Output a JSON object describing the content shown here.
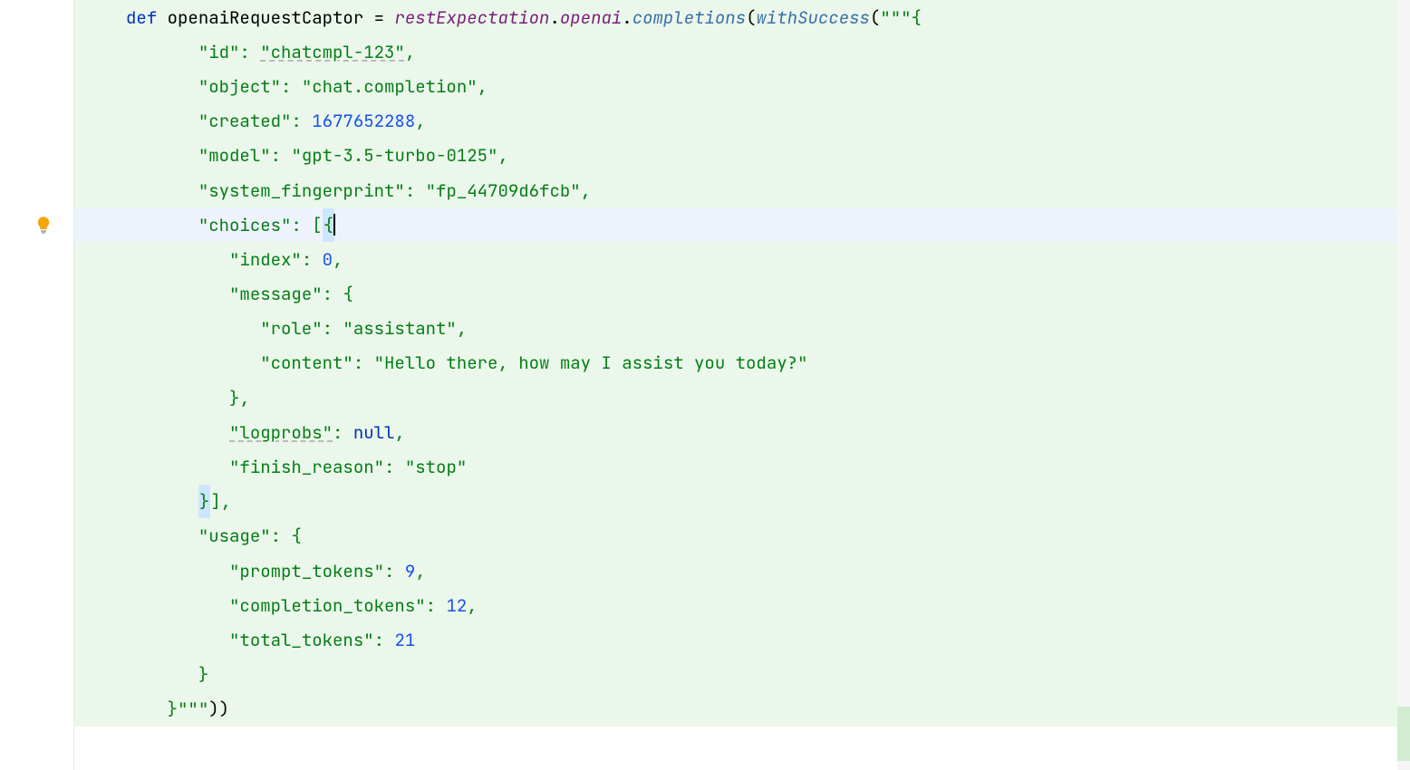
{
  "code": {
    "line1": {
      "indent": "     ",
      "kw_def": "def",
      "sp1": " ",
      "ident": "openaiRequestCaptor",
      "sp2": " ",
      "eq": "=",
      "sp3": " ",
      "member": "restExpectation",
      "dot1": ".",
      "openai": "openai",
      "dot2": ".",
      "completions": "completions",
      "paren_open": "(",
      "withSuccess": "withSuccess",
      "paren2": "(",
      "triple": "\"\"\"",
      "brace": "{"
    },
    "line2": {
      "indent": "            ",
      "key": "\"id\"",
      "colon": ": ",
      "val": "\"chatcmpl-123\"",
      "comma": ","
    },
    "line3": {
      "indent": "            ",
      "key": "\"object\"",
      "colon": ": ",
      "val": "\"chat.completion\"",
      "comma": ","
    },
    "line4": {
      "indent": "            ",
      "key": "\"created\"",
      "colon": ": ",
      "val": "1677652288",
      "comma": ","
    },
    "line5": {
      "indent": "            ",
      "key": "\"model\"",
      "colon": ": ",
      "val": "\"gpt-3.5-turbo-0125\"",
      "comma": ","
    },
    "line6": {
      "indent": "            ",
      "key": "\"system_fingerprint\"",
      "colon": ": ",
      "val": "\"fp_44709d6fcb\"",
      "comma": ","
    },
    "line7": {
      "indent": "            ",
      "key": "\"choices\"",
      "colon": ": ",
      "bracket": "[",
      "brace": "{"
    },
    "line8": {
      "indent": "               ",
      "key": "\"index\"",
      "colon": ": ",
      "val": "0",
      "comma": ","
    },
    "line9": {
      "indent": "               ",
      "key": "\"message\"",
      "colon": ": ",
      "brace": "{"
    },
    "line10": {
      "indent": "                  ",
      "key": "\"role\"",
      "colon": ": ",
      "val": "\"assistant\"",
      "comma": ","
    },
    "line11": {
      "indent": "                  ",
      "key": "\"content\"",
      "colon": ": ",
      "val": "\"Hello there, how may I assist you today?\""
    },
    "line12": {
      "indent": "               ",
      "brace": "}",
      "comma": ","
    },
    "line13": {
      "indent": "               ",
      "key": "\"logprobs\"",
      "colon": ": ",
      "val": "null",
      "comma": ","
    },
    "line14": {
      "indent": "               ",
      "key": "\"finish_reason\"",
      "colon": ": ",
      "val": "\"stop\""
    },
    "line15": {
      "indent": "            ",
      "brace": "}",
      "bracket": "]",
      "comma": ","
    },
    "line16": {
      "indent": "            ",
      "key": "\"usage\"",
      "colon": ": ",
      "brace": "{"
    },
    "line17": {
      "indent": "               ",
      "key": "\"prompt_tokens\"",
      "colon": ": ",
      "val": "9",
      "comma": ","
    },
    "line18": {
      "indent": "               ",
      "key": "\"completion_tokens\"",
      "colon": ": ",
      "val": "12",
      "comma": ","
    },
    "line19": {
      "indent": "               ",
      "key": "\"total_tokens\"",
      "colon": ": ",
      "val": "21"
    },
    "line20": {
      "indent": "            ",
      "brace": "}"
    },
    "line21": {
      "indent": "         ",
      "brace": "}",
      "triple": "\"\"\"",
      "parens": "))"
    }
  },
  "icons": {
    "bulb": "intention-bulb-icon"
  }
}
